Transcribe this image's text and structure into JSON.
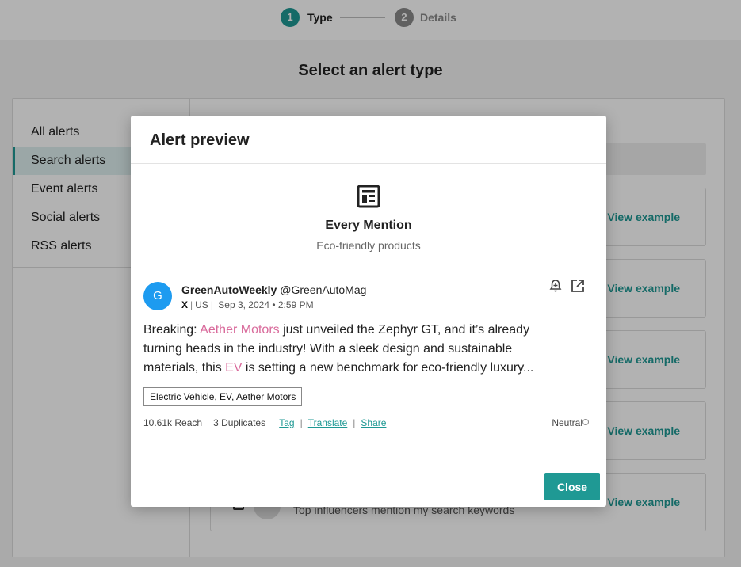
{
  "stepper": {
    "steps": [
      {
        "number": "1",
        "label": "Type"
      },
      {
        "number": "2",
        "label": "Details"
      }
    ]
  },
  "page": {
    "title": "Select an alert type"
  },
  "sidebar": {
    "items": [
      {
        "label": "All alerts"
      },
      {
        "label": "Search alerts"
      },
      {
        "label": "Event alerts"
      },
      {
        "label": "Social alerts"
      },
      {
        "label": "RSS alerts"
      }
    ],
    "selected": "Search alerts"
  },
  "cards": {
    "view_example_label": "View example",
    "last_card_description": "Top influencers mention my search keywords"
  },
  "modal": {
    "title": "Alert preview",
    "alert_type_icon": "newspaper-icon",
    "alert_type_title": "Every Mention",
    "alert_type_subtitle": "Eco-friendly products",
    "post": {
      "avatar_letter": "G",
      "author_name": "GreenAutoWeekly",
      "author_handle": "@GreenAutoMag",
      "platform": "X",
      "country": "US",
      "datetime": "Sep 3, 2024 • 2:59 PM",
      "text_parts": {
        "p1": "Breaking: ",
        "h1": "Aether Motors",
        "p2": " just unveiled the Zephyr GT, and it’s already turning heads in the industry! With a sleek design and sustainable materials, this ",
        "h2": "EV",
        "p3": " is setting a new benchmark for eco-friendly luxury..."
      },
      "tags": "Electric Vehicle, EV, Aether Motors",
      "reach": "10.61k Reach",
      "duplicates": "3 Duplicates",
      "actions": {
        "tag": "Tag",
        "translate": "Translate",
        "share": "Share"
      },
      "sentiment": "Neutral"
    },
    "close_label": "Close"
  },
  "colors": {
    "accent": "#1f9994",
    "highlight": "#d96a9b",
    "x_avatar": "#1d9bf0"
  }
}
